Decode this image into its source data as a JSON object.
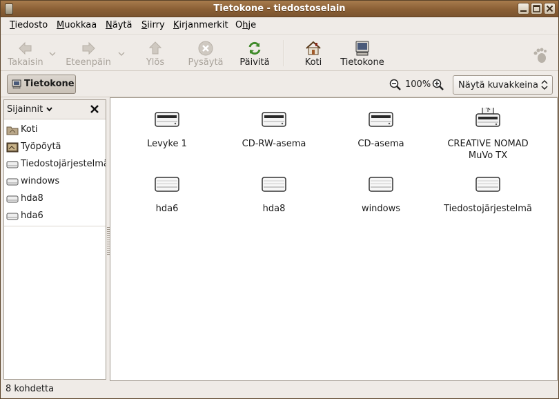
{
  "window": {
    "title": "Tietokone - tiedostoselain",
    "controls": [
      "minimize-icon",
      "maximize-icon",
      "close-icon"
    ]
  },
  "menu": [
    {
      "first": "T",
      "rest": "iedosto"
    },
    {
      "first": "M",
      "rest": "uokkaa"
    },
    {
      "first": "N",
      "rest": "äytä"
    },
    {
      "first": "S",
      "rest": "iirry"
    },
    {
      "first": "K",
      "rest": "irjanmerkit"
    },
    {
      "first": "O",
      "rest": "hje",
      "underline_index": 1
    }
  ],
  "toolbar": {
    "back": "Takaisin",
    "forward": "Eteenpäin",
    "up": "Ylös",
    "stop": "Pysäytä",
    "reload": "Päivitä",
    "home": "Koti",
    "computer": "Tietokone"
  },
  "location": {
    "current": "Tietokone",
    "zoom": "100%",
    "view_mode": "Näytä kuvakkeina"
  },
  "sidebar": {
    "title": "Sijainnit",
    "items": [
      {
        "label": "Koti",
        "icon": "home-folder-icon"
      },
      {
        "label": "Työpöytä",
        "icon": "desktop-icon"
      },
      {
        "label": "Tiedostojärjestelmä",
        "icon": "drive-icon"
      },
      {
        "label": "windows",
        "icon": "drive-icon"
      },
      {
        "label": "hda8",
        "icon": "drive-icon"
      },
      {
        "label": "hda6",
        "icon": "drive-icon"
      }
    ]
  },
  "files": [
    {
      "label": "Levyke 1",
      "icon": "floppy-drive-icon"
    },
    {
      "label": "CD-RW-asema",
      "icon": "cdrom-drive-icon"
    },
    {
      "label": "CD-asema",
      "icon": "cdrom-drive-icon"
    },
    {
      "label": "CREATIVE NOMAD MuVo TX",
      "icon": "usb-drive-icon"
    },
    {
      "label": "hda6",
      "icon": "harddisk-icon"
    },
    {
      "label": "hda8",
      "icon": "harddisk-icon"
    },
    {
      "label": "windows",
      "icon": "harddisk-icon"
    },
    {
      "label": "Tiedostojärjestelmä",
      "icon": "harddisk-icon"
    }
  ],
  "status": "8 kohdetta",
  "colors": {
    "titlebar": "#8a5f35",
    "window_bg": "#efebe7",
    "disabled_text": "#a9a39b"
  }
}
